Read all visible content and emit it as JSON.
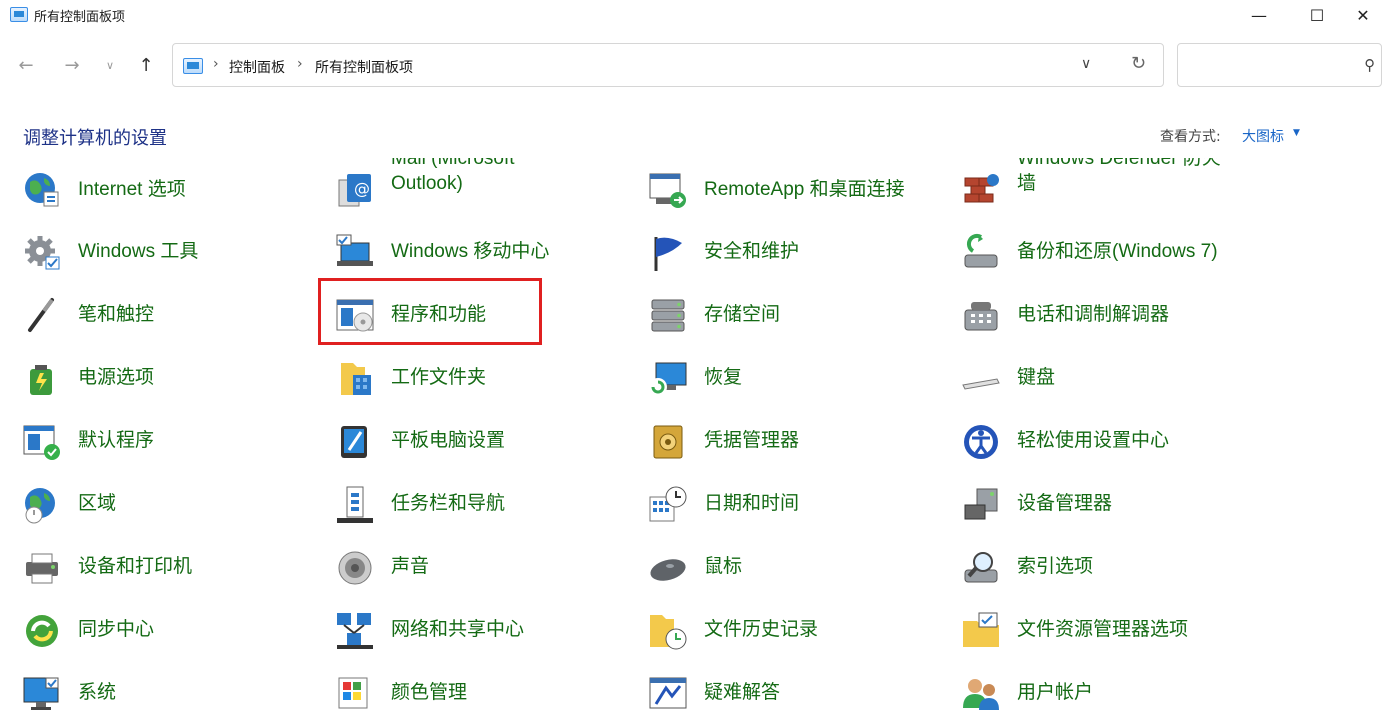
{
  "window": {
    "title": "所有控制面板项",
    "minimize": "—",
    "maximize": "☐",
    "close": "✕"
  },
  "nav": {
    "back": "←",
    "forward": "→",
    "history": "∨",
    "up": "↑",
    "breadcrumb": [
      "控制面板",
      "所有控制面板项"
    ],
    "separator": "›",
    "dropdown": "∨",
    "refresh": "↻",
    "search_placeholder": "",
    "search_glyph": "⚲"
  },
  "header": {
    "title": "调整计算机的设置",
    "view_label": "查看方式:",
    "view_value": "大图标",
    "view_caret": "▼"
  },
  "highlight_item": "程序和功能",
  "columns": [
    [
      {
        "label": "Internet 选项",
        "icon": "globe-icon"
      },
      {
        "label": "Windows 工具",
        "icon": "gear-icon"
      },
      {
        "label": "笔和触控",
        "icon": "pen-icon"
      },
      {
        "label": "电源选项",
        "icon": "battery-icon"
      },
      {
        "label": "默认程序",
        "icon": "default-programs-icon"
      },
      {
        "label": "区域",
        "icon": "region-globe-icon"
      },
      {
        "label": "设备和打印机",
        "icon": "printer-icon"
      },
      {
        "label": "同步中心",
        "icon": "sync-icon"
      },
      {
        "label": "系统",
        "icon": "monitor-icon"
      }
    ],
    [
      {
        "label": "Mail (Microsoft",
        "label2": "Outlook)",
        "icon": "mail-icon"
      },
      {
        "label": "Windows 移动中心",
        "icon": "laptop-icon"
      },
      {
        "label": "程序和功能",
        "icon": "programs-icon"
      },
      {
        "label": "工作文件夹",
        "icon": "work-folder-icon"
      },
      {
        "label": "平板电脑设置",
        "icon": "tablet-icon"
      },
      {
        "label": "任务栏和导航",
        "icon": "taskbar-icon"
      },
      {
        "label": "声音",
        "icon": "speaker-icon"
      },
      {
        "label": "网络和共享中心",
        "icon": "network-icon"
      },
      {
        "label": "颜色管理",
        "icon": "color-icon"
      }
    ],
    [
      {
        "label": "RemoteApp 和桌面连接",
        "icon": "remoteapp-icon"
      },
      {
        "label": "安全和维护",
        "icon": "flag-icon"
      },
      {
        "label": "存储空间",
        "icon": "storage-icon"
      },
      {
        "label": "恢复",
        "icon": "recovery-icon"
      },
      {
        "label": "凭据管理器",
        "icon": "vault-icon"
      },
      {
        "label": "日期和时间",
        "icon": "clock-icon"
      },
      {
        "label": "鼠标",
        "icon": "mouse-icon"
      },
      {
        "label": "文件历史记录",
        "icon": "file-history-icon"
      },
      {
        "label": "疑难解答",
        "icon": "troubleshoot-icon"
      }
    ],
    [
      {
        "label": "Windows Defender 防火",
        "label2": "墙",
        "icon": "firewall-icon"
      },
      {
        "label": "备份和还原(Windows 7)",
        "icon": "backup-icon"
      },
      {
        "label": "电话和调制解调器",
        "icon": "phone-icon"
      },
      {
        "label": "键盘",
        "icon": "keyboard-icon"
      },
      {
        "label": "轻松使用设置中心",
        "icon": "accessibility-icon"
      },
      {
        "label": "设备管理器",
        "icon": "device-manager-icon"
      },
      {
        "label": "索引选项",
        "icon": "index-icon"
      },
      {
        "label": "文件资源管理器选项",
        "icon": "folder-options-icon"
      },
      {
        "label": "用户帐户",
        "icon": "users-icon"
      }
    ]
  ]
}
